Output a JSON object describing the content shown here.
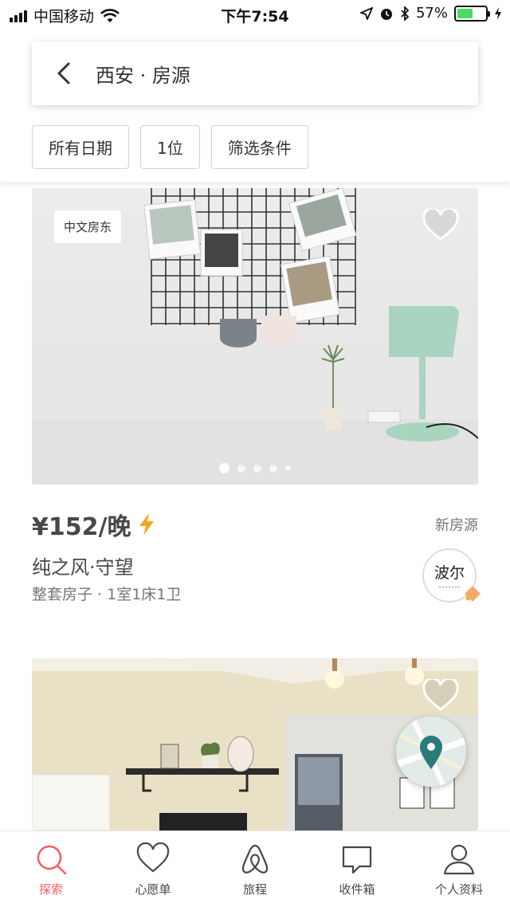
{
  "status_bar": {
    "carrier": "中国移动",
    "time": "下午7:54",
    "battery_percent": "57%",
    "battery_level": 0.57
  },
  "header": {
    "title": "西安 · 房源",
    "back_icon": "chevron-left-icon"
  },
  "filters": [
    {
      "label": "所有日期"
    },
    {
      "label": "1位"
    },
    {
      "label": "筛选条件"
    }
  ],
  "listings": [
    {
      "badge": "中文房东",
      "price": "¥152/晚",
      "instant_book_icon": "lightning-icon",
      "new_tag": "新房源",
      "title": "纯之风·守望",
      "subtitle": "整套房子 · 1室1床1卫",
      "host_logo_text": "波尔",
      "photo_count": 5,
      "active_photo": 1
    }
  ],
  "colors": {
    "accent": "#ff5a5f",
    "lightning": "#f5a623",
    "map_pin": "#2a7c7a"
  },
  "tab_bar": {
    "items": [
      {
        "label": "探索",
        "icon": "search-icon",
        "active": true
      },
      {
        "label": "心愿单",
        "icon": "heart-icon",
        "active": false
      },
      {
        "label": "旅程",
        "icon": "airbnb-logo-icon",
        "active": false
      },
      {
        "label": "收件箱",
        "icon": "message-icon",
        "active": false
      },
      {
        "label": "个人资料",
        "icon": "person-icon",
        "active": false
      }
    ]
  }
}
